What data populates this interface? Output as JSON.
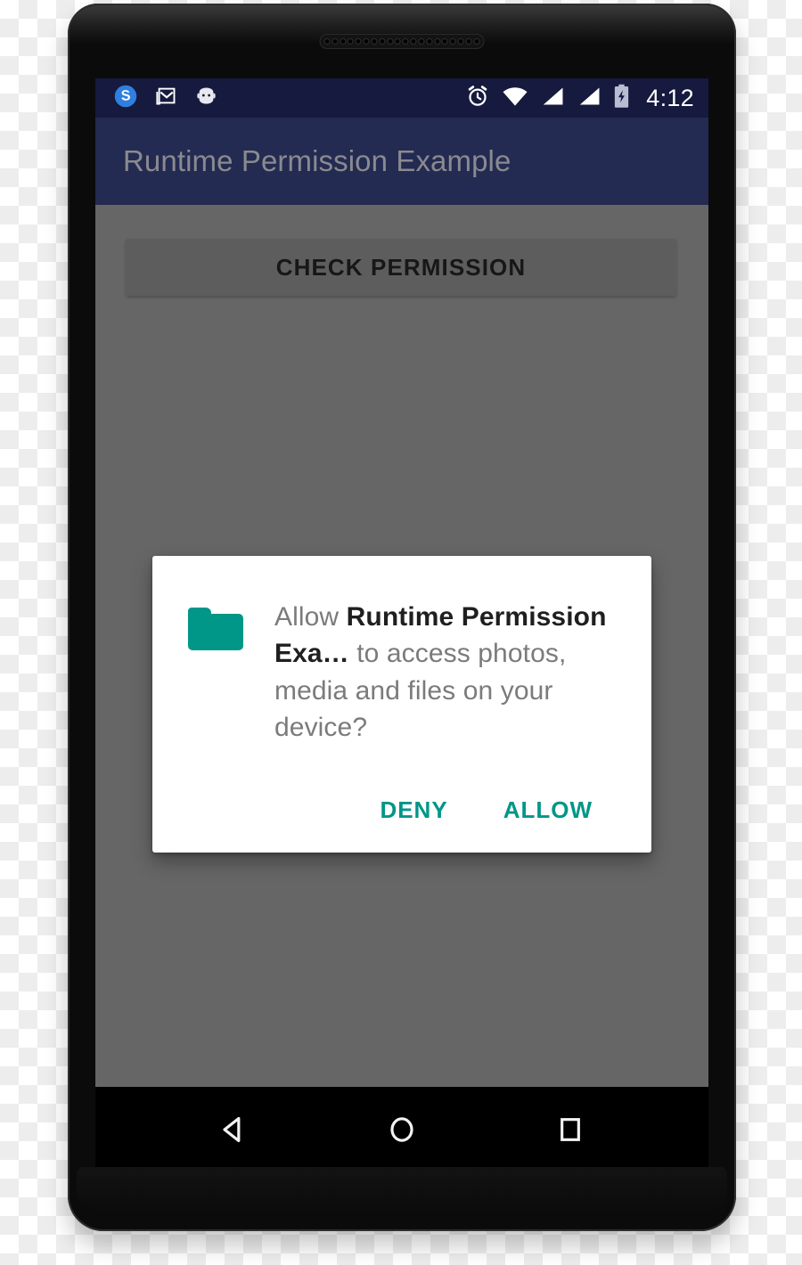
{
  "device": {
    "type": "android-phone-mockup",
    "frame_color": "#0b0b0b"
  },
  "statusbar": {
    "time": "4:12",
    "background_color": "#151a3e",
    "left_icons": [
      {
        "name": "skype-icon",
        "label": "S"
      },
      {
        "name": "gmail-icon",
        "label": "M"
      },
      {
        "name": "android-robot-icon",
        "label": "Android"
      }
    ],
    "right_icons": [
      {
        "name": "alarm-clock-icon",
        "label": "Alarm set"
      },
      {
        "name": "wifi-icon",
        "label": "Wi-Fi"
      },
      {
        "name": "signal-sim1-icon",
        "label": "Signal 1"
      },
      {
        "name": "signal-sim2-icon",
        "label": "Signal 2"
      },
      {
        "name": "battery-charging-icon",
        "label": "Battery charging"
      }
    ]
  },
  "appbar": {
    "title": "Runtime Permission Example",
    "background_color": "#232b52",
    "title_color": "#8a8a8f"
  },
  "content": {
    "background_color": "#666666",
    "check_permission_button": "CHECK PERMISSION"
  },
  "dialog": {
    "icon": "folder-icon",
    "icon_color": "#009688",
    "message_prefix": "Allow ",
    "message_app_name": "Runtime Permission Exa…",
    "message_suffix": " to access photos, media and files on your device?",
    "buttons": {
      "deny": "DENY",
      "allow": "ALLOW"
    },
    "button_color": "#009688",
    "background_color": "#ffffff"
  },
  "navbar": {
    "background_color": "#000000",
    "buttons": [
      {
        "name": "back-icon",
        "label": "Back"
      },
      {
        "name": "home-icon",
        "label": "Home"
      },
      {
        "name": "recents-icon",
        "label": "Recent apps"
      }
    ]
  }
}
